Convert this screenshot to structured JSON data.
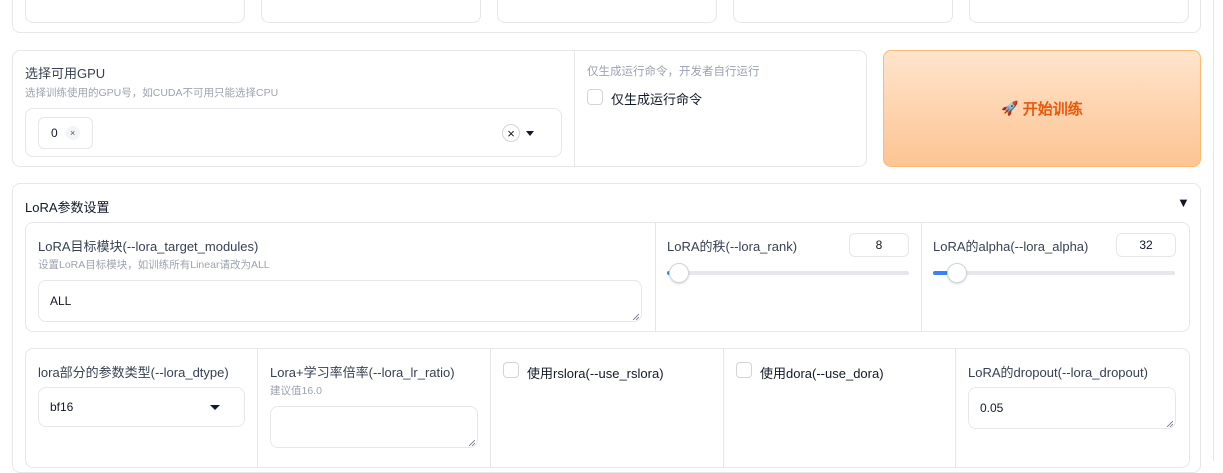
{
  "gpu": {
    "label": "选择可用GPU",
    "info": "选择训练使用的GPU号，如CUDA不可用只能选择CPU",
    "selected_token": "0",
    "token_remove": "×",
    "clear_icon": "×"
  },
  "cmd_only": {
    "info": "仅生成运行命令，开发者自行运行",
    "label": "仅生成运行命令",
    "checked": false
  },
  "start_button": {
    "emoji": "🚀",
    "label": "开始训练"
  },
  "lora": {
    "section_title": "LoRA参数设置",
    "collapse_icon": "▼",
    "target_modules": {
      "label": "LoRA目标模块(--lora_target_modules)",
      "info": "设置LoRA目标模块，如训练所有Linear请改为ALL",
      "value": "ALL"
    },
    "rank": {
      "label": "LoRA的秩(--lora_rank)",
      "value": "8",
      "slider_fraction": 0.02
    },
    "alpha": {
      "label": "LoRA的alpha(--lora_alpha)",
      "value": "32",
      "slider_fraction": 0.1
    },
    "dtype": {
      "label": "lora部分的参数类型(--lora_dtype)",
      "value": "bf16"
    },
    "lr_ratio": {
      "label": "Lora+学习率倍率(--lora_lr_ratio)",
      "info": "建议值16.0",
      "value": ""
    },
    "rslora": {
      "label": "使用rslora(--use_rslora)",
      "checked": false
    },
    "dora": {
      "label": "使用dora(--use_dora)",
      "checked": false
    },
    "dropout": {
      "label": "LoRA的dropout(--lora_dropout)",
      "value": "0.05"
    }
  },
  "colors": {
    "accent": "#3b82f6",
    "start_bg_top": "#fee4cc",
    "start_bg_bottom": "#fdc493",
    "start_text": "#ea580c"
  }
}
